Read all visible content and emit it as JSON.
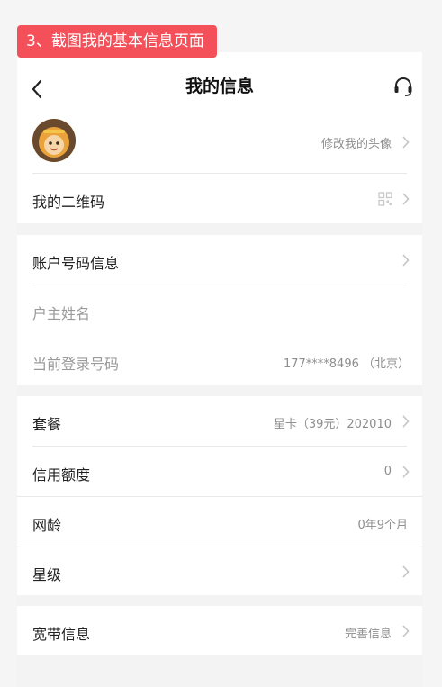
{
  "step_tag": "3、截图我的基本信息页面",
  "header": {
    "title": "我的信息"
  },
  "profile": {
    "avatar_action": "修改我的头像",
    "qrcode_label": "我的二维码"
  },
  "account": {
    "section_label": "账户号码信息",
    "owner_label": "户主姓名",
    "owner_value": "",
    "phone_label": "当前登录号码",
    "phone_value": "177****8496 （北京）"
  },
  "plan": {
    "package_label": "套餐",
    "package_value": "星卡（39元）202010",
    "credit_label": "信用额度",
    "credit_value": "0",
    "age_label": "网龄",
    "age_value": "0年9个月",
    "level_label": "星级",
    "level_value": ""
  },
  "broadband": {
    "label": "宽带信息",
    "value": "完善信息"
  },
  "colors": {
    "tag_bg": "#f4505a",
    "page_bg": "#f3f3f3"
  }
}
